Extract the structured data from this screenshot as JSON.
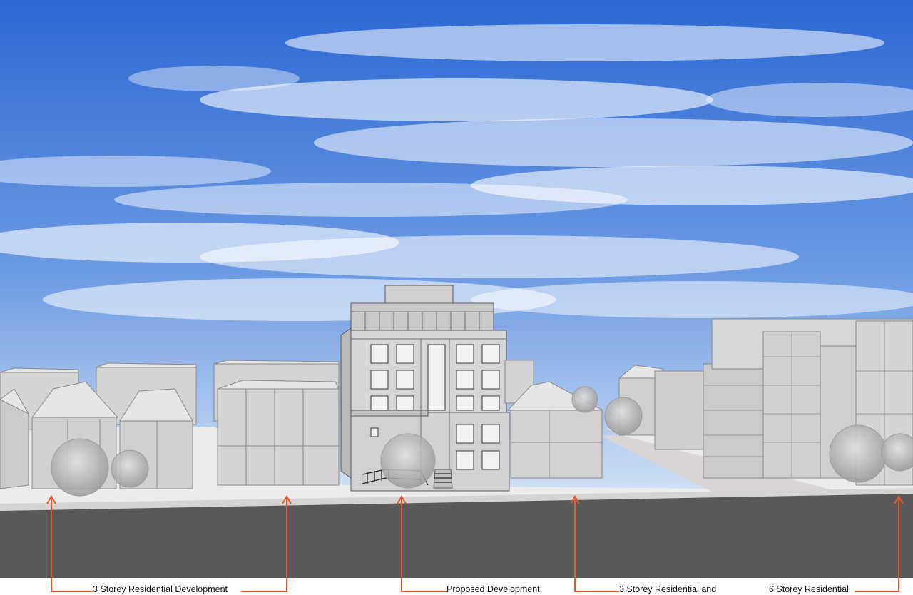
{
  "labels": {
    "left_residential": "3 Storey Residential Development",
    "proposed": "Proposed Development",
    "right_residential": "3 Storey Residential and",
    "far_right_residential": "6 Storey Residential"
  },
  "colors": {
    "sky_top": "#2f6fd6",
    "sky_bottom": "#cfe0f5",
    "building_face": "#d2d2d2",
    "building_side": "#bdbdbd",
    "roof": "#e6e6e6",
    "road": "#5a5858",
    "sidewalk": "#efefef",
    "leader_arrow": "#e2582a",
    "outline": "#8a8a8a"
  }
}
